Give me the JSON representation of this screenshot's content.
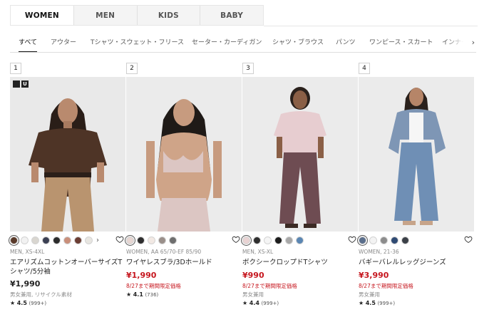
{
  "gender_tabs": [
    {
      "label": "WOMEN",
      "active": true
    },
    {
      "label": "MEN",
      "active": false
    },
    {
      "label": "KIDS",
      "active": false
    },
    {
      "label": "BABY",
      "active": false
    }
  ],
  "category_tabs": [
    {
      "label": "すべて",
      "active": true
    },
    {
      "label": "アウター"
    },
    {
      "label": "Tシャツ・スウェット・フリース"
    },
    {
      "label": "セーター・カーディガン"
    },
    {
      "label": "シャツ・ブラウス"
    },
    {
      "label": "パンツ"
    },
    {
      "label": "ワンピース・スカート"
    },
    {
      "label": "インナー"
    }
  ],
  "category_next_icon": "chevron-right-icon",
  "products": [
    {
      "rank": "1",
      "badge": [
        "",
        "U"
      ],
      "swatches": [
        "#5a3a2a",
        "#f2f2f2",
        "#d9d6d0",
        "#3b3f52",
        "#2b2b2b",
        "#c98f7a",
        "#6b3d33",
        "#e8e6e1"
      ],
      "has_more_swatches": true,
      "more_icon": "chevron-right-icon",
      "meta": "MEN, XS-4XL",
      "name": "エアリズムコットンオーバーサイズTシャツ/5分袖",
      "price": "¥1,990",
      "price_sale": false,
      "promo": "",
      "note": "男女兼用, リサイクル素材",
      "rating": "4.5",
      "reviews": "(999+)"
    },
    {
      "rank": "2",
      "swatches": [
        "#e7d6d2",
        "#2e2e2e",
        "#f2e9e4",
        "#9a8f8a",
        "#6e6e6e"
      ],
      "has_more_swatches": false,
      "meta": "WOMEN, AA 65/70-EF 85/90",
      "name": "ワイヤレスブラ/3Dホールド",
      "price": "¥1,990",
      "price_sale": true,
      "promo": "8/27まで期間限定価格",
      "note": "",
      "rating": "4.1",
      "reviews": "(736)"
    },
    {
      "rank": "3",
      "swatches": [
        "#e9d3d3",
        "#2f2f2f",
        "#f5f5f5",
        "#1c1c1c",
        "#a8a8a8",
        "#5a86b3"
      ],
      "has_more_swatches": false,
      "meta": "MEN, XS-XL",
      "name": "ボクシークロップドTシャツ",
      "price": "¥990",
      "price_sale": true,
      "promo": "8/27まで期間限定価格",
      "note": "男女兼用",
      "rating": "4.4",
      "reviews": "(999+)"
    },
    {
      "rank": "4",
      "swatches": [
        "#5b6f8c",
        "#f3f3f3",
        "#8c8c8c",
        "#2f4a73",
        "#3a3f47"
      ],
      "has_more_swatches": false,
      "meta": "WOMEN, 21-36",
      "name": "バギーバレルレッグジーンズ",
      "price": "¥3,990",
      "price_sale": true,
      "promo": "8/27まで期間限定価格",
      "note": "男女兼用",
      "rating": "4.5",
      "reviews": "(999+)"
    }
  ],
  "icons": {
    "favorite": "heart-icon",
    "rating": "star-icon"
  },
  "colors": {
    "sale_red": "#c6161e",
    "text": "#1b1b1b",
    "muted": "#8a8a8a"
  }
}
